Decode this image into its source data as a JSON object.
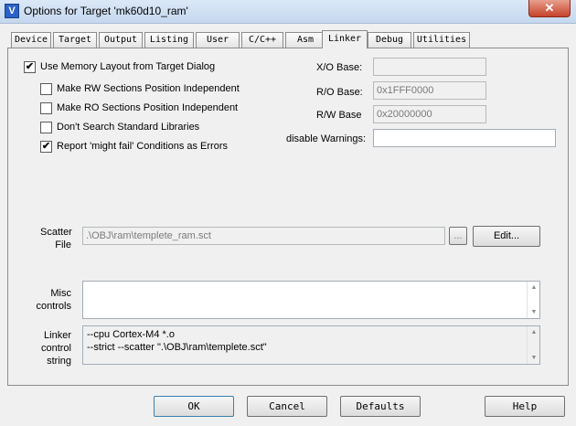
{
  "window": {
    "title": "Options for Target 'mk60d10_ram'",
    "app_icon_glyph": "V",
    "close_glyph": "✕"
  },
  "tabs": [
    {
      "label": "Device"
    },
    {
      "label": "Target"
    },
    {
      "label": "Output"
    },
    {
      "label": "Listing"
    },
    {
      "label": "User"
    },
    {
      "label": "C/C++"
    },
    {
      "label": "Asm"
    },
    {
      "label": "Linker"
    },
    {
      "label": "Debug"
    },
    {
      "label": "Utilities"
    }
  ],
  "active_tab": "Linker",
  "options": {
    "use_memory_layout": {
      "label": "Use Memory Layout from Target Dialog",
      "checked": true,
      "mark": "✔"
    },
    "rw_independent": {
      "label": "Make RW Sections Position Independent",
      "checked": false,
      "mark": ""
    },
    "ro_independent": {
      "label": "Make RO Sections Position Independent",
      "checked": false,
      "mark": ""
    },
    "dont_search_libs": {
      "label": "Don't Search Standard Libraries",
      "checked": false,
      "mark": ""
    },
    "might_fail_errors": {
      "label": "Report 'might fail' Conditions as Errors",
      "checked": true,
      "mark": "✔"
    }
  },
  "bases": {
    "xo_label": "X/O Base:",
    "xo_value": "",
    "ro_label": "R/O Base:",
    "ro_value": "0x1FFF0000",
    "rw_label": "R/W Base",
    "rw_value": "0x20000000",
    "warnings_label": "disable Warnings:",
    "warnings_value": ""
  },
  "scatter": {
    "label_line1": "Scatter",
    "label_line2": "File",
    "value": ".\\OBJ\\ram\\templete_ram.sct",
    "browse_label": "...",
    "edit_label": "Edit..."
  },
  "misc": {
    "label_line1": "Misc",
    "label_line2": "controls",
    "value": ""
  },
  "linker_string": {
    "label_line1": "Linker",
    "label_line2": "control",
    "label_line3": "string",
    "line1": "--cpu Cortex-M4 *.o",
    "line2": "--strict --scatter \".\\OBJ\\ram\\templete.sct\""
  },
  "scroll_glyphs": {
    "up": "▲",
    "down": "▼"
  },
  "buttons": {
    "ok": "OK",
    "cancel": "Cancel",
    "defaults": "Defaults",
    "help": "Help"
  }
}
